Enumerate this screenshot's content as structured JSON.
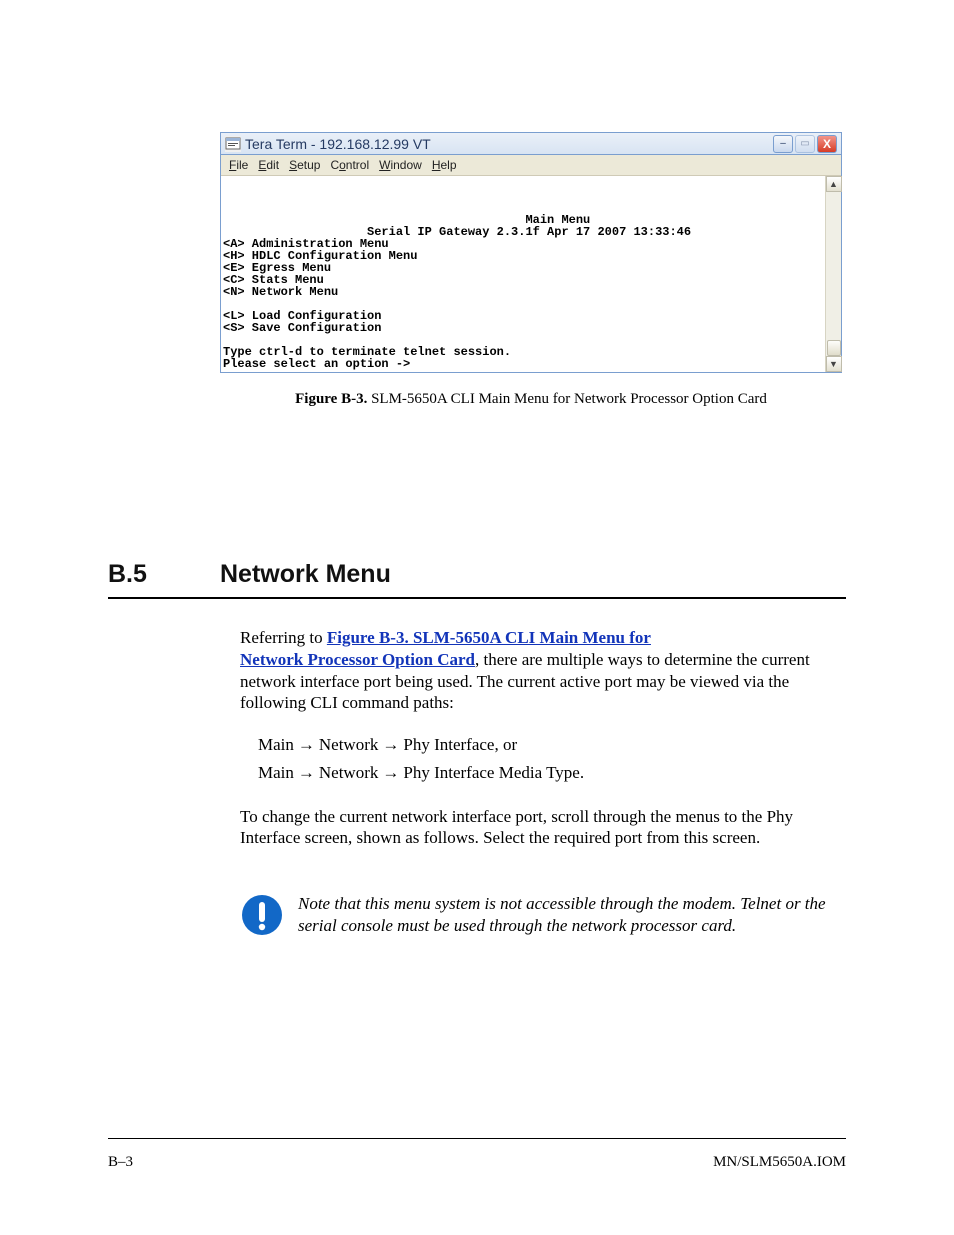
{
  "window": {
    "title": "Tera Term - 192.168.12.99 VT",
    "menus": {
      "file": "File",
      "edit": "Edit",
      "setup": "Setup",
      "control": "Control",
      "window": "Window",
      "help": "Help"
    },
    "buttons": {
      "min": "–",
      "max": "▭",
      "close": "X"
    }
  },
  "terminal": {
    "blank_top": "\n\n\n",
    "title_line": "                                          Main Menu",
    "version_line": "                    Serial IP Gateway 2.3.1f Apr 17 2007 13:33:46",
    "items": {
      "a": "<A> Administration Menu",
      "h": "<H> HDLC Configuration Menu",
      "e": "<E> Egress Menu",
      "c": "<C> Stats Menu",
      "n": "<N> Network Menu",
      "l": "<L> Load Configuration",
      "s": "<S> Save Configuration"
    },
    "instr1": "Type ctrl-d to terminate telnet session.",
    "instr2": "Please select an option ->"
  },
  "figure": {
    "label": "Figure B-3.",
    "caption": " SLM-5650A CLI Main Menu for Network Processor Option Card"
  },
  "section": {
    "number": "B.5",
    "title": "Network Menu"
  },
  "body": {
    "p1a": "Referring to ",
    "figref": "Figure B-3. SLM-5650A CLI Main Menu for",
    "p1b_line2": "Network Processor Option Card",
    "p1c": ", there are multiple ways to determine the current network interface port being used. The current active port may be viewed via the following CLI command paths:",
    "nav1": {
      "a": "Main",
      "b": "Network",
      "c": "Phy Interface, or"
    },
    "nav2": {
      "a": "Main",
      "b": "Network",
      "c": "Phy Interface Media Type."
    },
    "p2": "To change the current network interface port, scroll through the menus to the Phy Interface screen, shown as follows. Select the required port from this screen.",
    "note": "Note that this menu system is not accessible through the modem. Telnet or the serial console must be used through the network processor card."
  },
  "footer": {
    "left": "B–3",
    "right": "MN/SLM5650A.IOM"
  }
}
